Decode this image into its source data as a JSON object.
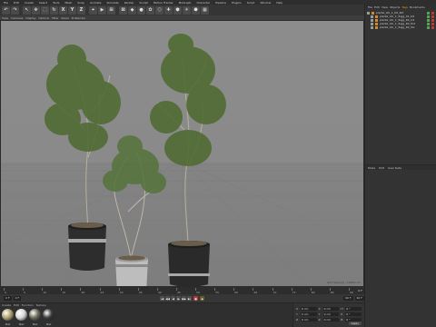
{
  "menu": {
    "items": [
      "File",
      "Edit",
      "Create",
      "Select",
      "Tools",
      "Mesh",
      "Snap",
      "Animate",
      "Simulate",
      "Render",
      "Sculpt",
      "Motion Tracker",
      "MoGraph",
      "Character",
      "Pipeline",
      "Plugins",
      "Script",
      "Window",
      "Help"
    ]
  },
  "toolbar": {
    "buttons": [
      "↶",
      "↷",
      "↖",
      "✥",
      "⬚",
      "↻",
      "X",
      "Y",
      "Z",
      "⌖",
      "▶",
      "⊞",
      "⊠",
      "◆",
      "●",
      "✿",
      "⬡",
      "✚",
      "⬢",
      "☀",
      "⬣",
      "▦"
    ]
  },
  "viewport_menu": [
    "View",
    "Cameras",
    "Display",
    "Options",
    "Filter",
    "Panel",
    "ProRender"
  ],
  "viewport": {
    "grid_spacing": "Grid Spacing : 10000 cm"
  },
  "object_manager": {
    "tabs": [
      "File",
      "Edit",
      "View",
      "Objects",
      "Tags",
      "Bookmarks"
    ],
    "active_tab": "Tags",
    "objects": [
      {
        "name": "plants_Vol_1_Kit_Pot",
        "child": false
      },
      {
        "name": "plants_Vol_1_Tugg_01_Kit",
        "child": true
      },
      {
        "name": "plants_Vol_1_Tugg_Kit_C4",
        "child": true
      },
      {
        "name": "plants_Vol_1_Tugg_Kit_Pot",
        "child": true
      },
      {
        "name": "plants_Vol_1_Tugg_Kit_SG",
        "child": true
      }
    ]
  },
  "attributes_manager": {
    "tabs": [
      "Mode",
      "Edit",
      "User Data"
    ]
  },
  "timeline": {
    "ticks": [
      "0",
      "5",
      "10",
      "15",
      "20",
      "25",
      "30",
      "35",
      "40",
      "45",
      "50",
      "55",
      "60",
      "65",
      "70",
      "75",
      "80",
      "85",
      "90"
    ],
    "current_frame": "0 F"
  },
  "transport": {
    "start": "0 F",
    "current": "0 F",
    "end": "90 F",
    "max": "90 F",
    "buttons": [
      "|◀",
      "◀◀",
      "◀",
      "▶",
      "▶▶",
      "▶|"
    ]
  },
  "material_manager": {
    "tabs": [
      "Create",
      "Edit",
      "Function",
      "Texture"
    ],
    "materials": [
      {
        "label": "Mat",
        "color": "#b0a46e"
      },
      {
        "label": "Mat",
        "color": "#d8d8d8"
      },
      {
        "label": "Mat",
        "color": "#6b6b5a"
      },
      {
        "label": "Mat",
        "color": "#3c3c3c"
      }
    ]
  },
  "coordinates": {
    "rows": [
      {
        "a": "X",
        "av": "0 cm",
        "b": "X",
        "bv": "0 cm",
        "c": "H",
        "cv": "0 °"
      },
      {
        "a": "Y",
        "av": "0 cm",
        "b": "Y",
        "bv": "0 cm",
        "c": "P",
        "cv": "0 °"
      },
      {
        "a": "Z",
        "av": "0 cm",
        "b": "Z",
        "bv": "0 cm",
        "c": "B",
        "cv": "0 °"
      }
    ],
    "apply_label": "Apply"
  },
  "colors": {
    "accent": "#e0a200",
    "viewport_bg": "#8a8a8a",
    "pot_dark": "#2d2d2d",
    "pot_white": "#bdbdbd",
    "foliage": "#4c6a2e"
  }
}
